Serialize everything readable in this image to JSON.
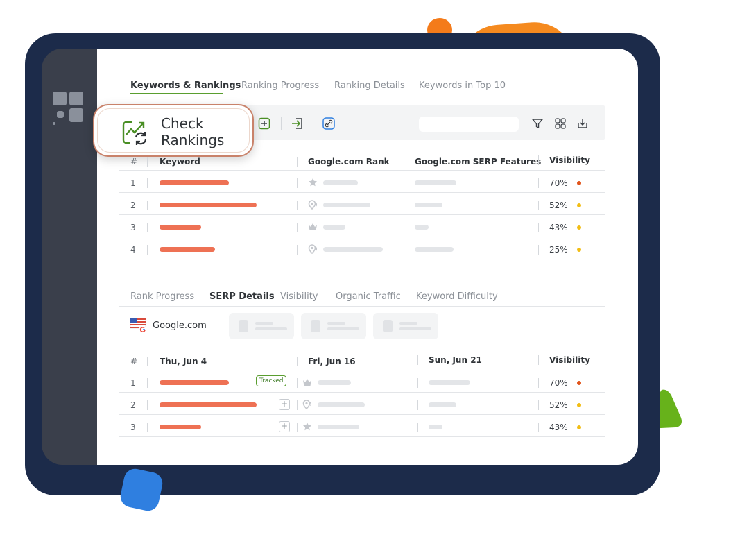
{
  "top_tabs": [
    {
      "label": "Keywords & Rankings",
      "active": true
    },
    {
      "label": "Ranking Progress",
      "active": false
    },
    {
      "label": "Ranking Details",
      "active": false
    },
    {
      "label": "Keywords in Top 10",
      "active": false
    }
  ],
  "toolbar": {
    "check_rankings_label_line1": "Check",
    "check_rankings_label_line2": "Rankings",
    "icons": [
      "add-icon",
      "import-icon",
      "link-icon",
      "filter-icon",
      "grid-icon",
      "download-icon"
    ],
    "search_placeholder": ""
  },
  "table1": {
    "headers": {
      "hash": "#",
      "keyword": "Keyword",
      "rank": "Google.com Rank",
      "serp": "Google.com SERP Features",
      "visibility": "Visibility"
    },
    "rows": [
      {
        "n": "1",
        "rank_icon": "star-icon",
        "visibility": "70%",
        "dot_color": "#e2541b"
      },
      {
        "n": "2",
        "rank_icon": "location-pin-icon",
        "visibility": "52%",
        "dot_color": "#f2bd14"
      },
      {
        "n": "3",
        "rank_icon": "crown-icon",
        "visibility": "43%",
        "dot_color": "#f2bd14"
      },
      {
        "n": "4",
        "rank_icon": "location-pin-icon",
        "visibility": "25%",
        "dot_color": "#f2bd14"
      }
    ]
  },
  "bottom_tabs": [
    {
      "label": "Rank Progress",
      "active": false
    },
    {
      "label": "SERP Details",
      "active": true
    },
    {
      "label": "Visibility",
      "active": false
    },
    {
      "label": "Organic Traffic",
      "active": false
    },
    {
      "label": "Keyword Difficulty",
      "active": false
    }
  ],
  "engine": {
    "label": "Google.com",
    "flag_icon": "us-flag-google-icon"
  },
  "table2": {
    "headers": {
      "hash": "#",
      "col1": "Thu, Jun 4",
      "col2": "Fri, Jun 16",
      "col3": "Sun, Jun 21",
      "visibility": "Visibility"
    },
    "tracked_label": "Tracked",
    "rows": [
      {
        "n": "1",
        "rank_icon": "crown-icon",
        "visibility": "70%",
        "dot_color": "#e2541b"
      },
      {
        "n": "2",
        "rank_icon": "location-pin-icon",
        "visibility": "52%",
        "dot_color": "#f2bd14"
      },
      {
        "n": "3",
        "rank_icon": "star-icon",
        "visibility": "43%",
        "dot_color": "#f2bd14"
      }
    ]
  },
  "colors": {
    "accent_green": "#5a9e2f",
    "bar_orange": "#ee7154",
    "frame_navy": "#1c2b4a",
    "sidebar_gray": "#3a3f4b"
  }
}
